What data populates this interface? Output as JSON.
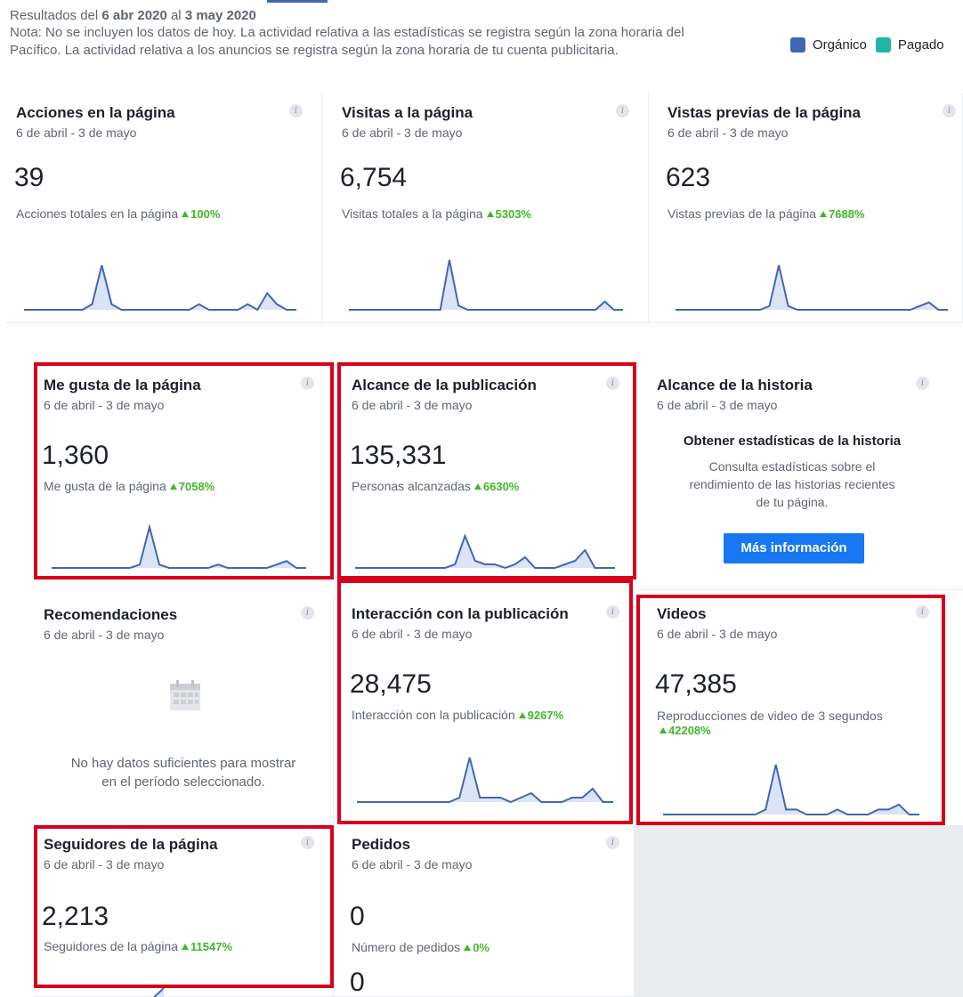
{
  "header": {
    "results_prefix": "Resultados del ",
    "start": "6 abr 2020",
    "mid": " al ",
    "end": "3 may 2020",
    "note_line1": "Nota: No se incluyen los datos de hoy. La actividad relativa a las estadísticas se registra según la zona horaria del",
    "note_line2": "Pacífico. La actividad relativa a los anuncios se registra según la zona horaria de tu cuenta publicitaria."
  },
  "legend": {
    "organic": "Orgánico",
    "paid": "Pagado",
    "organic_color": "#4267b2",
    "paid_color": "#20b7a0"
  },
  "cards": {
    "acciones": {
      "title": "Acciones en la página",
      "range": "6 de abril - 3 de mayo",
      "value": "39",
      "label": "Acciones totales en la página",
      "pct": "100%"
    },
    "visitas": {
      "title": "Visitas a la página",
      "range": "6 de abril - 3 de mayo",
      "value": "6,754",
      "label": "Visitas totales a la página",
      "pct": "5303%"
    },
    "vistas": {
      "title": "Vistas previas de la página",
      "range": "6 de abril - 3 de mayo",
      "value": "623",
      "label": "Vistas previas de la página",
      "pct": "7688%"
    },
    "megusta": {
      "title": "Me gusta de la página",
      "range": "6 de abril - 3 de mayo",
      "value": "1,360",
      "label": "Me gusta de la página",
      "pct": "7058%"
    },
    "alcance": {
      "title": "Alcance de la publicación",
      "range": "6 de abril - 3 de mayo",
      "value": "135,331",
      "label": "Personas alcanzadas",
      "pct": "6630%"
    },
    "historia": {
      "title": "Alcance de la historia",
      "range": "6 de abril - 3 de mayo",
      "heading": "Obtener estadísticas de la historia",
      "desc1": "Consulta estadísticas sobre el",
      "desc2": "rendimiento de las historias recientes",
      "desc3": "de tu página.",
      "button": "Más información"
    },
    "recomendaciones": {
      "title": "Recomendaciones",
      "range": "6 de abril - 3 de mayo",
      "empty1": "No hay datos suficientes para mostrar",
      "empty2": "en el período seleccionado."
    },
    "interaccion": {
      "title": "Interacción con la publicación",
      "range": "6 de abril - 3 de mayo",
      "value": "28,475",
      "label": "Interacción con la publicación",
      "pct": "9267%"
    },
    "videos": {
      "title": "Videos",
      "range": "6 de abril - 3 de mayo",
      "value": "47,385",
      "label": "Reproducciones de video de 3 segundos",
      "pct": "42208%"
    },
    "seguidores": {
      "title": "Seguidores de la página",
      "range": "6 de abril - 3 de mayo",
      "value": "2,213",
      "label": "Seguidores de la página",
      "pct": "11547%"
    },
    "pedidos": {
      "title": "Pedidos",
      "range": "6 de abril - 3 de mayo",
      "value": "0",
      "label": "Número de pedidos",
      "pct": "0%",
      "value2": "0"
    }
  },
  "sparklines": {
    "acciones": [
      0,
      0,
      0,
      0,
      0,
      0,
      0,
      1,
      8,
      1,
      0,
      0,
      0,
      0,
      0,
      0,
      0,
      0,
      1,
      0,
      0,
      0,
      0,
      1,
      0,
      3,
      1,
      0,
      0
    ],
    "visitas": [
      0,
      0,
      0,
      0,
      0,
      0,
      0,
      0,
      0,
      0,
      0,
      12,
      1,
      0,
      0,
      0,
      0,
      0,
      0,
      0,
      0,
      0,
      0,
      0,
      0,
      0,
      0,
      0,
      2,
      0,
      0
    ],
    "vistas": [
      0,
      0,
      0,
      0,
      0,
      0,
      0,
      0,
      0,
      0,
      1,
      12,
      1,
      0,
      0,
      0,
      0,
      0,
      0,
      0,
      0,
      0,
      0,
      0,
      0,
      0,
      1,
      2,
      0,
      0
    ],
    "megusta": [
      0,
      0,
      0,
      0,
      0,
      0,
      0,
      0,
      0,
      1,
      12,
      1,
      0,
      0,
      0,
      0,
      0,
      1,
      0,
      0,
      0,
      0,
      0,
      1,
      2,
      0,
      0
    ],
    "alcance": [
      0,
      0,
      0,
      0,
      0,
      0,
      0,
      0,
      0,
      0,
      1,
      9,
      2,
      1,
      1,
      0,
      1,
      3,
      0,
      0,
      0,
      1,
      2,
      5,
      0,
      0,
      0
    ],
    "interaccion": [
      0,
      0,
      0,
      0,
      0,
      0,
      0,
      0,
      0,
      0,
      1,
      10,
      1,
      1,
      1,
      0,
      1,
      2,
      0,
      0,
      0,
      1,
      1,
      3,
      0,
      0
    ],
    "videos": [
      0,
      0,
      0,
      0,
      0,
      0,
      0,
      0,
      0,
      0,
      1,
      10,
      1,
      1,
      0,
      0,
      0,
      1,
      0,
      0,
      0,
      1,
      1,
      2,
      0,
      0
    ],
    "seguidores": [
      0,
      0,
      0,
      0,
      0,
      0,
      0,
      0,
      0,
      0,
      1,
      10
    ]
  }
}
